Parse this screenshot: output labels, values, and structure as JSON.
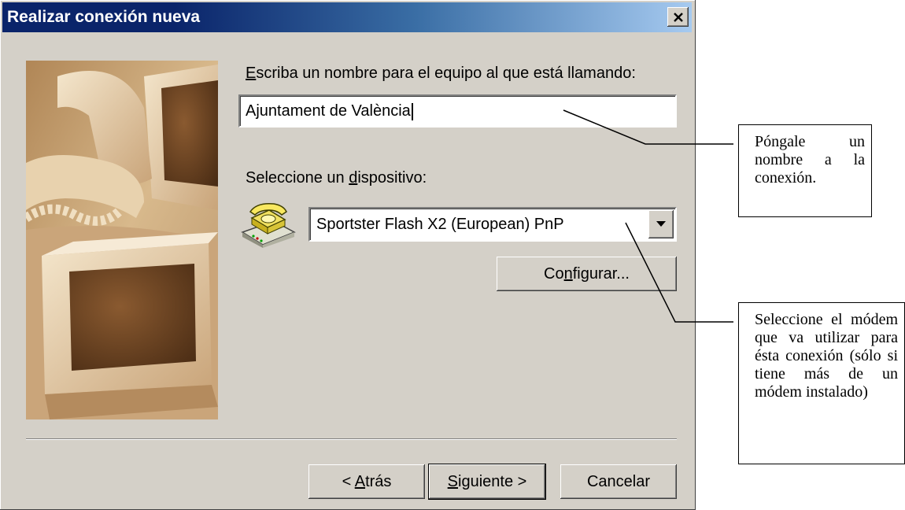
{
  "window": {
    "title": "Realizar conexión nueva",
    "close_glyph": "×"
  },
  "name_field": {
    "label_first": "E",
    "label_rest": "scriba un nombre para el equipo al que está llamando:",
    "value": "Ajuntament de València"
  },
  "device": {
    "label_pre": "Seleccione un ",
    "label_u": "d",
    "label_post": "ispositivo:",
    "selected": "Sportster Flash X2 (European) PnP",
    "icon": "telephone-modem-icon"
  },
  "buttons": {
    "configure_pre": "Co",
    "configure_u": "n",
    "configure_post": "figurar...",
    "back_pre": "< ",
    "back_u": "A",
    "back_post": "trás",
    "next_u": "S",
    "next_post": "iguiente >",
    "cancel": "Cancelar"
  },
  "annotations": {
    "name_note": "Póngale un nombre a la conexión.",
    "modem_note": "Seleccione el módem que va utilizar para ésta conexión (sólo si tiene más de un módem instalado)"
  },
  "colors": {
    "dialog_face": "#d4d0c8",
    "title_start": "#0a246a",
    "title_end": "#a6caf0"
  }
}
